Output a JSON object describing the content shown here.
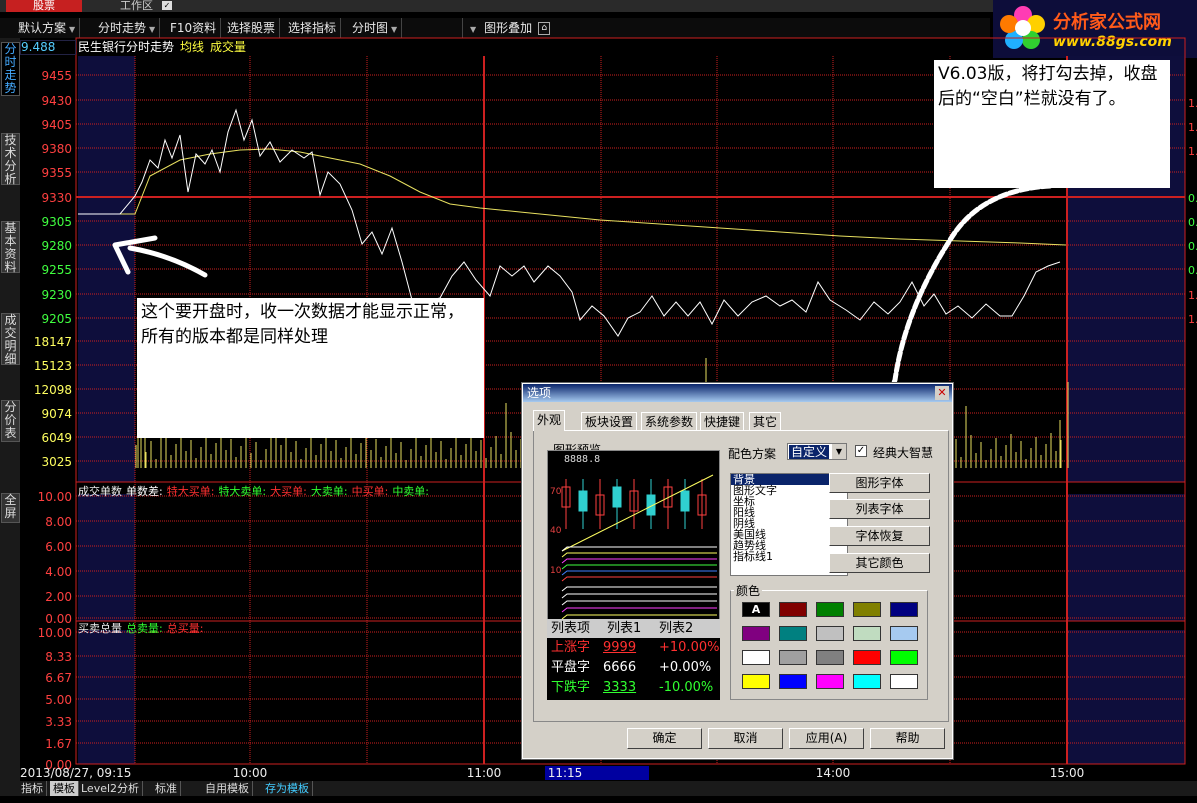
{
  "app": {
    "active_tab": "股票",
    "work_tab": "工作区",
    "work_check": "✓"
  },
  "toolbar": [
    {
      "label": "默认方案",
      "dropdown": true
    },
    {
      "label": "分时走势",
      "dropdown": true
    },
    {
      "label": "F10资料",
      "dropdown": false
    },
    {
      "label": "选择股票",
      "dropdown": false
    },
    {
      "label": "选择指标",
      "dropdown": false
    },
    {
      "label": "分时图",
      "dropdown": true
    },
    {
      "label": "图形叠加",
      "dropdown": true
    }
  ],
  "logo": {
    "name": "分析家公式网",
    "url": "www.88gs.com"
  },
  "left_tabs": [
    "分时走势",
    "技术分析",
    "基本资料",
    "成交明细",
    "分价表",
    "全屏"
  ],
  "chart": {
    "title": "民生银行分时走势",
    "avg_label": "均线",
    "vol_label": "成交量",
    "current_price": "9.488",
    "price_ticks": [
      "9455",
      "9430",
      "9405",
      "9380",
      "9355",
      "9330",
      "9305",
      "9280",
      "9255",
      "9230",
      "9205"
    ],
    "volume_ticks": [
      "18147",
      "15123",
      "12098",
      "9074",
      "6049",
      "3025"
    ],
    "right_ticks": [
      "1.",
      "1.",
      "1.",
      "0.",
      "0.",
      "0.",
      "0.",
      "1.",
      "1."
    ],
    "time_ticks": [
      "2013/08/27, 09:15",
      "10:00",
      "11:00",
      "11:15",
      "14:00",
      "15:00"
    ],
    "series_colors": {
      "price": "#ffffff",
      "average": "#e8e060",
      "grid": "#cc2020",
      "volume": "#e8e060"
    }
  },
  "sub1": {
    "title": "成交单数",
    "items": [
      "单数差:",
      "特大买单:",
      "特大卖单:",
      "大买单:",
      "大卖单:",
      "中买单:",
      "中卖单:"
    ],
    "ticks": [
      "10.00",
      "8.00",
      "6.00",
      "4.00",
      "2.00",
      "0.00"
    ]
  },
  "sub2": {
    "title": "买卖总量",
    "items": [
      "总卖量:",
      "总买量:"
    ],
    "ticks": [
      "10.00",
      "8.33",
      "6.67",
      "5.00",
      "3.33",
      "1.67",
      "0.00"
    ]
  },
  "notes": {
    "left": "这个要开盘时，收一次数据才能显示正常，所有的版本都是同样处理",
    "right": "V6.03版，将打勾去掉，收盘后的“空白”栏就没有了。"
  },
  "bottom_tabs": [
    "指标",
    "模板",
    "Level2分析",
    "标准",
    "自用模板",
    "存为模板"
  ],
  "dialog": {
    "title": "选项",
    "tabs": [
      "外观",
      "板块设置",
      "系统参数",
      "快捷键",
      "其它"
    ],
    "preview_label": "图形预览",
    "preview_price": "8888.8",
    "preview_axis": [
      "70",
      "40",
      "10"
    ],
    "color_scheme_label": "配色方案",
    "color_scheme_value": "自定义",
    "classic_label": "经典大智慧",
    "classic_checked": "✓",
    "elements": [
      "背景",
      "图形文字",
      "坐标",
      "阳线",
      "阴线",
      "美国线",
      "趋势线",
      "指标线1"
    ],
    "side_buttons": [
      "图形字体",
      "列表字体",
      "字体恢复",
      "其它颜色"
    ],
    "colors_label": "颜色",
    "swatch_first_label": "A",
    "swatches": [
      "#000000",
      "#800000",
      "#008000",
      "#808000",
      "#000080",
      "#800080",
      "#008080",
      "#c0c0c0",
      "#c0dcc0",
      "#a6caf0",
      "#ffffff",
      "#a0a0a0",
      "#808080",
      "#ff0000",
      "#00ff00",
      "#ffff00",
      "#0000ff",
      "#ff00ff",
      "#00ffff",
      "#ffffff"
    ],
    "list_header": [
      "列表项",
      "列表1",
      "列表2"
    ],
    "list_rows": [
      {
        "name": "上涨字",
        "v1": "9999",
        "v2": "+10.00%",
        "color": "#ff3030"
      },
      {
        "name": "平盘字",
        "v1": "6666",
        "v2": "+0.00%",
        "color": "#ffffff"
      },
      {
        "name": "下跌字",
        "v1": "3333",
        "v2": "-10.00%",
        "color": "#30ff30"
      }
    ],
    "buttons": [
      "确定",
      "取消",
      "应用(A)",
      "帮助"
    ]
  }
}
